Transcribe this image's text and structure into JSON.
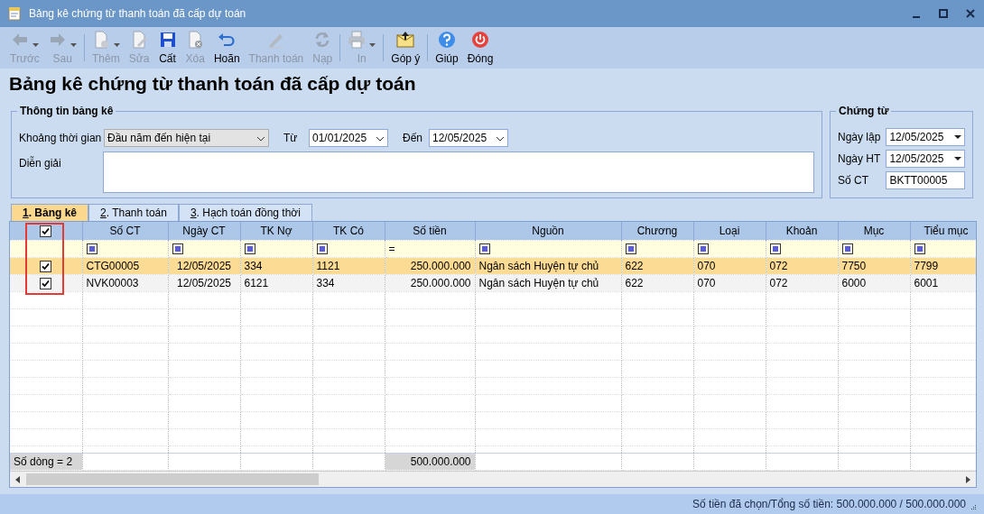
{
  "window": {
    "title": "Bảng kê chứng từ thanh toán đã cấp dự toán"
  },
  "toolbar_groups": [
    {
      "buttons": [
        {
          "label": "Trước",
          "disabled": true,
          "dropdown": true
        },
        {
          "label": "Sau",
          "disabled": true,
          "dropdown": true
        }
      ]
    },
    {
      "buttons": [
        {
          "label": "Thêm",
          "disabled": true,
          "dropdown": true
        },
        {
          "label": "Sửa",
          "disabled": true,
          "dropdown": false
        },
        {
          "label": "Cất",
          "disabled": false,
          "dropdown": false
        },
        {
          "label": "Xóa",
          "disabled": true,
          "dropdown": false
        },
        {
          "label": "Hoãn",
          "disabled": false,
          "dropdown": false
        },
        {
          "label": "Thanh toán",
          "disabled": true,
          "dropdown": false
        },
        {
          "label": "Nạp",
          "disabled": true,
          "dropdown": false
        }
      ]
    },
    {
      "buttons": [
        {
          "label": "In",
          "disabled": true,
          "dropdown": true
        }
      ]
    },
    {
      "buttons": [
        {
          "label": "Góp ý",
          "disabled": false,
          "dropdown": false
        }
      ]
    },
    {
      "buttons": [
        {
          "label": "Giúp",
          "disabled": false,
          "dropdown": false
        },
        {
          "label": "Đóng",
          "disabled": false,
          "dropdown": false
        }
      ]
    }
  ],
  "heading": "Bảng kê chứng từ thanh toán đã cấp dự toán",
  "info_group": {
    "title": "Thông tin bảng kê",
    "period": {
      "label": "Khoảng thời gian",
      "value": "Đầu năm đến hiện tại"
    },
    "from": {
      "label": "Từ",
      "value": "01/01/2025"
    },
    "to": {
      "label": "Đến",
      "value": "12/05/2025"
    },
    "description": {
      "label": "Diễn giải"
    }
  },
  "voucher_group": {
    "title": "Chứng từ",
    "fields": [
      {
        "label": "Ngày lập",
        "value": "12/05/2025",
        "kind": "date"
      },
      {
        "label": "Ngày HT",
        "value": "12/05/2025",
        "kind": "date"
      },
      {
        "label": "Số CT",
        "value": "BKTT00005",
        "kind": "text"
      }
    ]
  },
  "tabs": [
    {
      "label": "1. Bảng kê",
      "selected": true
    },
    {
      "label": "2. Thanh toán",
      "selected": false
    },
    {
      "label": "3. Hạch toán đồng thời",
      "selected": false
    }
  ],
  "grid": {
    "header_checked": true,
    "columns": [
      {
        "label": "Số CT",
        "kind": "text",
        "filter": {
          "kind": "icon"
        }
      },
      {
        "label": "Ngày CT",
        "kind": "date",
        "filter": {
          "kind": "icon"
        }
      },
      {
        "label": "TK Nợ",
        "kind": "text",
        "filter": {
          "kind": "icon"
        }
      },
      {
        "label": "TK Có",
        "kind": "text",
        "filter": {
          "kind": "icon"
        }
      },
      {
        "label": "Số tiền",
        "kind": "money",
        "filter": {
          "kind": "text",
          "text": "="
        }
      },
      {
        "label": "Nguồn",
        "kind": "text",
        "filter": {
          "kind": "icon"
        }
      },
      {
        "label": "Chương",
        "kind": "text",
        "filter": {
          "kind": "icon"
        }
      },
      {
        "label": "Loại",
        "kind": "text",
        "filter": {
          "kind": "icon"
        }
      },
      {
        "label": "Khoản",
        "kind": "text",
        "filter": {
          "kind": "icon"
        }
      },
      {
        "label": "Mục",
        "kind": "text",
        "filter": {
          "kind": "icon"
        }
      },
      {
        "label": "Tiểu mục",
        "kind": "text",
        "filter": {
          "kind": "icon"
        }
      }
    ],
    "rows": [
      {
        "checked": true,
        "selected": true,
        "cells": [
          "CTG00005",
          "12/05/2025",
          "334",
          "1121",
          "250.000.000",
          "Ngân sách Huyện tự chủ",
          "622",
          "070",
          "072",
          "7750",
          "7799"
        ]
      },
      {
        "checked": true,
        "selected": false,
        "cells": [
          "NVK00003",
          "12/05/2025",
          "6121",
          "334",
          "250.000.000",
          "Ngân sách Huyện tự chủ",
          "622",
          "070",
          "072",
          "6000",
          "6001"
        ]
      }
    ],
    "footer": {
      "count": "Số dòng = 2",
      "total": "500.000.000"
    }
  },
  "status_bar": "Số tiền đã chọn/Tổng số tiền: 500.000.000 / 500.000.000"
}
